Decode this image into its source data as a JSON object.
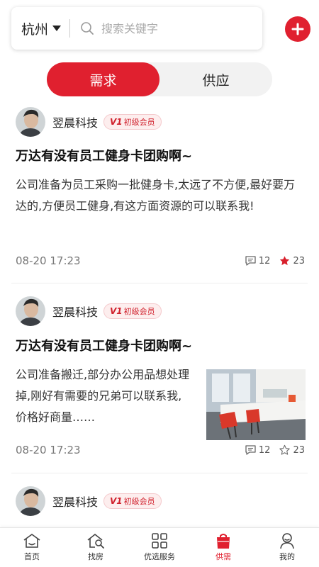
{
  "header": {
    "city": "杭州",
    "search_placeholder": "搜索关键字"
  },
  "tabs": [
    {
      "label": "需求",
      "active": true
    },
    {
      "label": "供应",
      "active": false
    }
  ],
  "colors": {
    "accent": "#e0202f"
  },
  "posts": [
    {
      "author": "翌晨科技",
      "badge": "初级会员",
      "badge_prefix": "V1",
      "title": "万达有没有员工健身卡团购啊~",
      "body": "公司准备为员工采购一批健身卡,太远了不方便,最好要万达的,方便员工健身,有这方面资源的可以联系我!",
      "time": "08-20 17:23",
      "comments": "12",
      "likes": "23",
      "liked": true
    },
    {
      "author": "翌晨科技",
      "badge": "初级会员",
      "badge_prefix": "V1",
      "title": "万达有没有员工健身卡团购啊~",
      "body": "公司准备搬迁,部分办公用品想处理掉,刚好有需要的兄弟可以联系我,价格好商量……",
      "time": "08-20 17:23",
      "comments": "12",
      "likes": "23",
      "liked": false,
      "thumbnail": "office-chairs-photo"
    },
    {
      "author": "翌晨科技",
      "badge": "初级会员",
      "badge_prefix": "V1"
    }
  ],
  "bottom_nav": [
    {
      "label": "首页",
      "icon": "home-icon"
    },
    {
      "label": "找房",
      "icon": "house-search-icon"
    },
    {
      "label": "优选服务",
      "icon": "grid-icon"
    },
    {
      "label": "供需",
      "icon": "shopping-bag-icon",
      "active": true
    },
    {
      "label": "我的",
      "icon": "user-icon"
    }
  ]
}
